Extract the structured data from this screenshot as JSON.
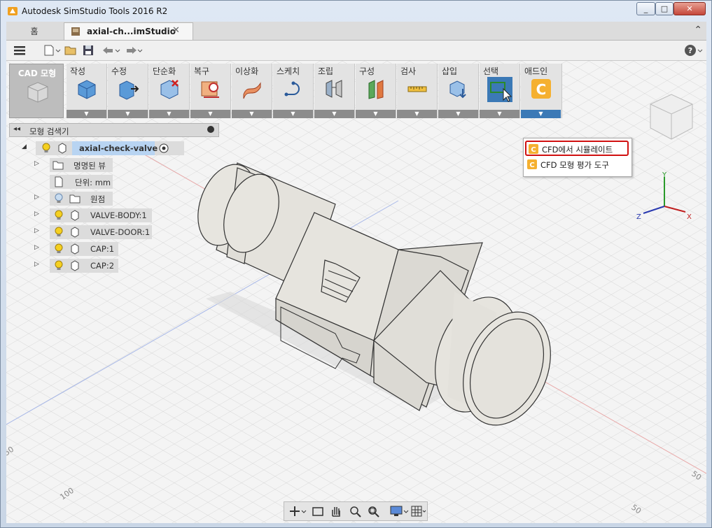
{
  "window": {
    "title": "Autodesk SimStudio Tools 2016 R2",
    "minimize": "_",
    "maximize": "□",
    "close": "✕"
  },
  "tabs": {
    "home": "홈",
    "document": "axial-ch...imStudio",
    "close_glyph": "✕",
    "collapse_glyph": "⌃"
  },
  "ribbon": {
    "mode_label": "CAD 모형",
    "groups": [
      {
        "label": "작성"
      },
      {
        "label": "수정"
      },
      {
        "label": "단순화"
      },
      {
        "label": "복구"
      },
      {
        "label": "이상화"
      },
      {
        "label": "스케치"
      },
      {
        "label": "조립"
      },
      {
        "label": "구성"
      },
      {
        "label": "검사"
      },
      {
        "label": "삽입"
      },
      {
        "label": "선택"
      },
      {
        "label": "애드인"
      }
    ]
  },
  "addin_menu": {
    "items": [
      {
        "label": "CFD에서 시뮬레이트"
      },
      {
        "label": "CFD 모형 평가 도구"
      }
    ]
  },
  "browser": {
    "title": "모형 검색기",
    "root": "axial-check-valve",
    "nodes": [
      {
        "label": "명명된 뷰"
      },
      {
        "label": "단위: mm"
      },
      {
        "label": "원점"
      },
      {
        "label": "VALVE-BODY:1"
      },
      {
        "label": "VALVE-DOOR:1"
      },
      {
        "label": "CAP:1"
      },
      {
        "label": "CAP:2"
      }
    ]
  },
  "viewcube": {
    "axis_x": "X",
    "axis_y": "Y",
    "axis_z": "Z"
  },
  "grid_labels": {
    "left_top": "50",
    "left_bottom": "100",
    "right_top": "50",
    "right_bottom": "50"
  },
  "colors": {
    "accent": "#3b79b6",
    "highlight_box": "#d01010",
    "cad_mode_bg": "#bdbdbd",
    "part_fill": "#e2e0da"
  }
}
